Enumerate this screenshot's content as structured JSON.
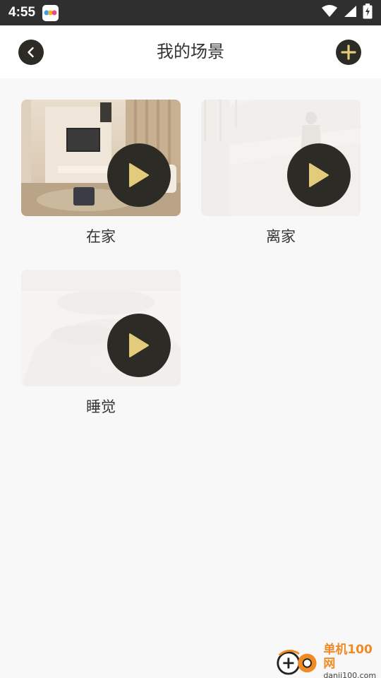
{
  "status_bar": {
    "time": "4:55",
    "icons": [
      "app-notification-icon",
      "wifi-icon",
      "signal-icon",
      "battery-charging-icon"
    ]
  },
  "header": {
    "title": "我的场景",
    "back_icon": "chevron-left-icon",
    "add_icon": "plus-icon"
  },
  "scenes": [
    {
      "label": "在家",
      "image": "living-room-photo",
      "active": true
    },
    {
      "label": "离家",
      "image": "person-leaving-photo",
      "active": false
    },
    {
      "label": "睡觉",
      "image": "sleeping-photo",
      "active": false
    }
  ],
  "colors": {
    "accent_gold": "#e2cb7a",
    "dark_button": "#2d2b26",
    "status_bar": "#2f2f2f",
    "background": "#f8f8f8"
  },
  "watermark": {
    "title": "单机100网",
    "url": "danji100.com"
  }
}
